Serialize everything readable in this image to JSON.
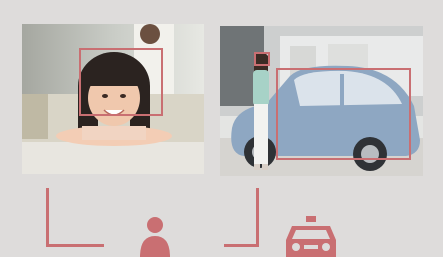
{
  "colors": {
    "background": "#dedcdb",
    "accent": "#c96f72"
  },
  "photos": [
    {
      "subject": "child-face-photo",
      "detections": [
        "face"
      ]
    },
    {
      "subject": "woman-and-car-photo",
      "detections": [
        "person",
        "car"
      ]
    }
  ],
  "icons": {
    "person": "person-icon",
    "car": "car-icon"
  }
}
